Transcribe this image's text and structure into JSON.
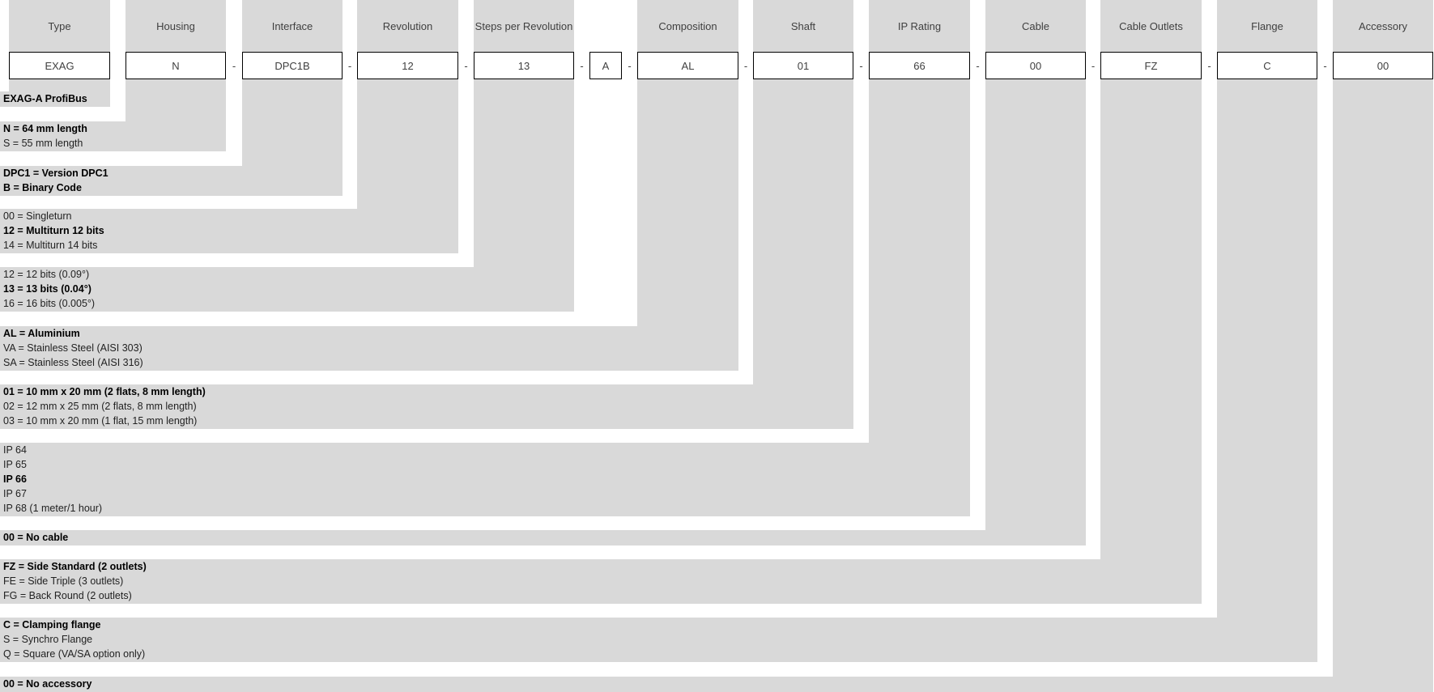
{
  "colors": {
    "panel": "#d9d9d9",
    "box_border": "#000000",
    "background": "#ffffff"
  },
  "separator": "-",
  "columns": [
    {
      "header": "Type",
      "value": "EXAG",
      "options": [
        {
          "text": "EXAG-A ProfiBus",
          "selected": true
        }
      ]
    },
    {
      "header": "Housing",
      "value": "N",
      "options": [
        {
          "text": "N = 64 mm length",
          "selected": true
        },
        {
          "text": "S = 55 mm length",
          "selected": false
        }
      ]
    },
    {
      "header": "Interface",
      "value": "DPC1B",
      "options": [
        {
          "text": "DPC1 = Version DPC1",
          "selected": true
        },
        {
          "text": "B = Binary Code",
          "selected": true
        }
      ]
    },
    {
      "header": "Revolution",
      "value": "12",
      "options": [
        {
          "text": "00 = Singleturn",
          "selected": false
        },
        {
          "text": "12 = Multiturn 12 bits",
          "selected": true
        },
        {
          "text": "14 = Multiturn 14 bits",
          "selected": false
        }
      ]
    },
    {
      "header": "Steps per Revolution",
      "value": "13",
      "options": [
        {
          "text": "12 = 12 bits (0.09°)",
          "selected": false
        },
        {
          "text": "13 = 13 bits (0.04°)",
          "selected": true
        },
        {
          "text": "16 = 16 bits (0.005°)",
          "selected": false
        }
      ]
    },
    {
      "header": "",
      "value": "A",
      "fixed": true,
      "options": []
    },
    {
      "header": "Composition",
      "value": "AL",
      "options": [
        {
          "text": "AL = Aluminium",
          "selected": true
        },
        {
          "text": "VA = Stainless Steel (AISI 303)",
          "selected": false
        },
        {
          "text": "SA = Stainless Steel (AISI 316)",
          "selected": false
        }
      ]
    },
    {
      "header": "Shaft",
      "value": "01",
      "options": [
        {
          "text": "01 = 10 mm x 20 mm (2 flats, 8 mm length)",
          "selected": true
        },
        {
          "text": "02 = 12 mm x 25 mm (2 flats, 8 mm length)",
          "selected": false
        },
        {
          "text": "03 = 10 mm x 20 mm (1 flat, 15 mm length)",
          "selected": false
        }
      ]
    },
    {
      "header": "IP Rating",
      "value": "66",
      "options": [
        {
          "text": "IP 64",
          "selected": false
        },
        {
          "text": "IP 65",
          "selected": false
        },
        {
          "text": "IP 66",
          "selected": true
        },
        {
          "text": "IP 67",
          "selected": false
        },
        {
          "text": "IP 68 (1 meter/1 hour)",
          "selected": false
        }
      ]
    },
    {
      "header": "Cable",
      "value": "00",
      "options": [
        {
          "text": "00 = No cable",
          "selected": true
        }
      ]
    },
    {
      "header": "Cable Outlets",
      "value": "FZ",
      "options": [
        {
          "text": "FZ = Side Standard (2 outlets)",
          "selected": true
        },
        {
          "text": "FE = Side Triple (3 outlets)",
          "selected": false
        },
        {
          "text": "FG = Back Round (2 outlets)",
          "selected": false
        }
      ]
    },
    {
      "header": "Flange",
      "value": "C",
      "options": [
        {
          "text": "C = Clamping flange",
          "selected": true
        },
        {
          "text": "S = Synchro Flange",
          "selected": false
        },
        {
          "text": "Q = Square (VA/SA option only)",
          "selected": false
        }
      ]
    },
    {
      "header": "Accessory",
      "value": "00",
      "options": [
        {
          "text": "00 = No accessory",
          "selected": true
        }
      ]
    }
  ]
}
